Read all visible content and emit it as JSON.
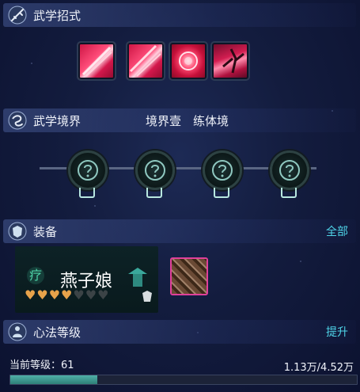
{
  "skills_section": {
    "title": "武学招式",
    "skill_icons": [
      "blade-slash-icon",
      "blade-slash-icon",
      "rose-seal-icon",
      "warrior-strike-icon"
    ]
  },
  "realm_section": {
    "title": "武学境界",
    "realm_level": "境界壹",
    "realm_name": "练体境",
    "nodes": [
      "locked-realm-node",
      "locked-realm-node",
      "locked-realm-node",
      "locked-realm-node"
    ]
  },
  "equip_section": {
    "title": "装备",
    "all_link": "全部",
    "card": {
      "badge_char": "疗",
      "name": "燕子娘",
      "hearts_filled": 4,
      "hearts_total": 7
    },
    "item_slot": "armor-item-icon"
  },
  "mind_section": {
    "title": "心法等级",
    "upgrade_link": "提升",
    "level_label": "当前等级：61",
    "progress_text": "1.13万/4.52万",
    "progress_fraction": 0.25
  },
  "colors": {
    "accent_cyan": "#4fd4e8",
    "heart_gold": "#e7a24a",
    "skill_red": "#d4184c",
    "progress": "#3a9a90"
  }
}
